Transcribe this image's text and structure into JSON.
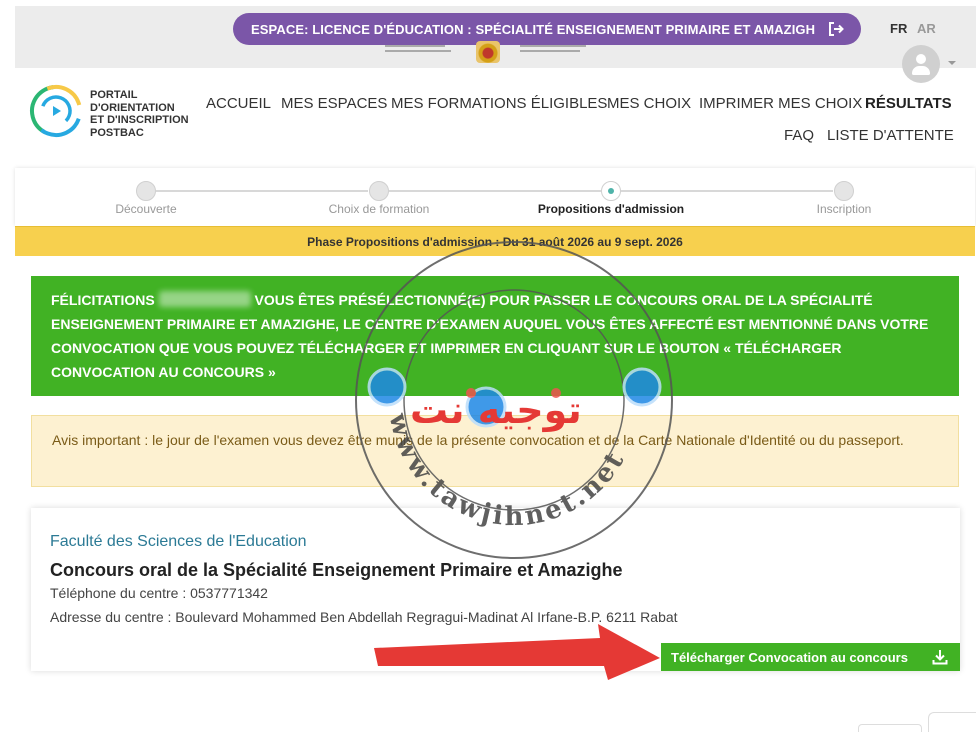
{
  "header": {
    "espace_label": "ESPACE: LICENCE D'ÉDUCATION : SPÉCIALITÉ ENSEIGNEMENT PRIMAIRE ET AMAZIGH",
    "lang_fr": "FR",
    "lang_ar": "AR"
  },
  "brand": {
    "line1": "PORTAIL",
    "line2": "D'ORIENTATION",
    "line3": "ET D'INSCRIPTION",
    "line4": "POSTBAC"
  },
  "nav": {
    "items": [
      {
        "label": "ACCUEIL"
      },
      {
        "label": "MES ESPACES"
      },
      {
        "label": "MES FORMATIONS ÉLIGIBLES"
      },
      {
        "label": "MES CHOIX"
      },
      {
        "label": "IMPRIMER MES CHOIX"
      },
      {
        "label": "RÉSULTATS",
        "active": true
      }
    ],
    "row2": [
      {
        "label": "FAQ"
      },
      {
        "label": "LISTE D'ATTENTE"
      }
    ]
  },
  "stepper": {
    "steps": [
      {
        "label": "Découverte"
      },
      {
        "label": "Choix de formation"
      },
      {
        "label": "Propositions d'admission",
        "current": true
      },
      {
        "label": "Inscription"
      }
    ]
  },
  "phase": {
    "text": "Phase Propositions d'admission : Du 31 août 2026 au 9 sept. 2026"
  },
  "congrats": {
    "prefix": "FÉLICITATIONS",
    "message": " VOUS ÊTES PRÉSÉLECTIONNÉ(E) POUR PASSER LE CONCOURS ORAL DE LA SPÉCIALITÉ ENSEIGNEMENT PRIMAIRE ET AMAZIGHE, LE CENTRE D'EXAMEN AUQUEL VOUS ÊTES AFFECTÉ EST MENTIONNÉ DANS VOTRE CONVOCATION QUE VOUS POUVEZ TÉLÉCHARGER ET IMPRIMER EN CLIQUANT SUR LE BOUTON « TÉLÉCHARGER CONVOCATION AU CONCOURS »"
  },
  "notice": {
    "text": "Avis important : le jour de l'examen vous devez être munis de la présente convocation et de la Carte Nationale d'Identité ou du passeport."
  },
  "center": {
    "faculty": "Faculté des Sciences de l'Education",
    "title": "Concours oral de la Spécialité Enseignement Primaire et Amazighe",
    "phone": "Téléphone du centre : 0537771342",
    "address": "Adresse du centre : Boulevard Mohammed Ben Abdellah Regragui-Madinat Al Irfane-B.P. 6211 Rabat",
    "download_label": "Télécharger Convocation au concours"
  },
  "watermark": {
    "arabic": "توجيه نت",
    "url": "www.tawjihnet.net",
    "small": "tawjihnet"
  },
  "colors": {
    "purple": "#7b56a8",
    "green": "#41b224",
    "yellow": "#f7d04e",
    "notice_bg": "#fdf1d1",
    "teal": "#2b7a95",
    "arrow_red": "#e53935"
  },
  "icons": {
    "exit": "logout-icon",
    "download": "download-icon",
    "avatar": "user-avatar-icon"
  }
}
